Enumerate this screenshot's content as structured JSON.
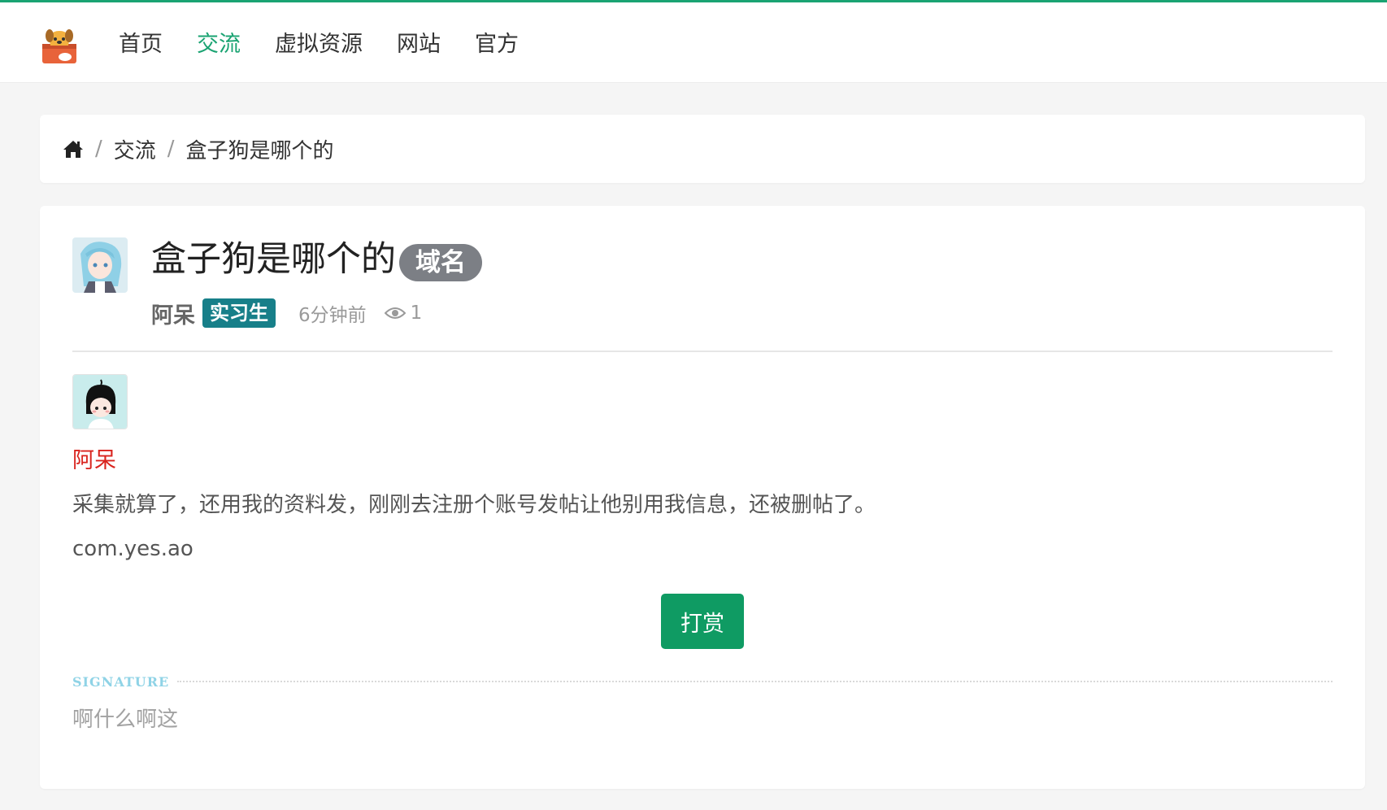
{
  "header": {
    "nav": [
      {
        "label": "首页",
        "active": false
      },
      {
        "label": "交流",
        "active": true
      },
      {
        "label": "虚拟资源",
        "active": false
      },
      {
        "label": "网站",
        "active": false
      },
      {
        "label": "官方",
        "active": false
      }
    ],
    "accent_color": "#1aa372"
  },
  "breadcrumb": {
    "items": [
      "交流",
      "盒子狗是哪个的"
    ]
  },
  "post": {
    "title": "盒子狗是哪个的",
    "tag": "域名",
    "author": "阿呆",
    "role": "实习生",
    "time": "6分钟前",
    "views": "1"
  },
  "reply": {
    "author": "阿呆",
    "text": "采集就算了，还用我的资料发，刚刚去注册个账号发帖让他别用我信息，还被删帖了。",
    "domain": "com.yes.ao",
    "tip_label": "打赏"
  },
  "signature": {
    "label": "SIGNATURE",
    "text": "啊什么啊这"
  }
}
